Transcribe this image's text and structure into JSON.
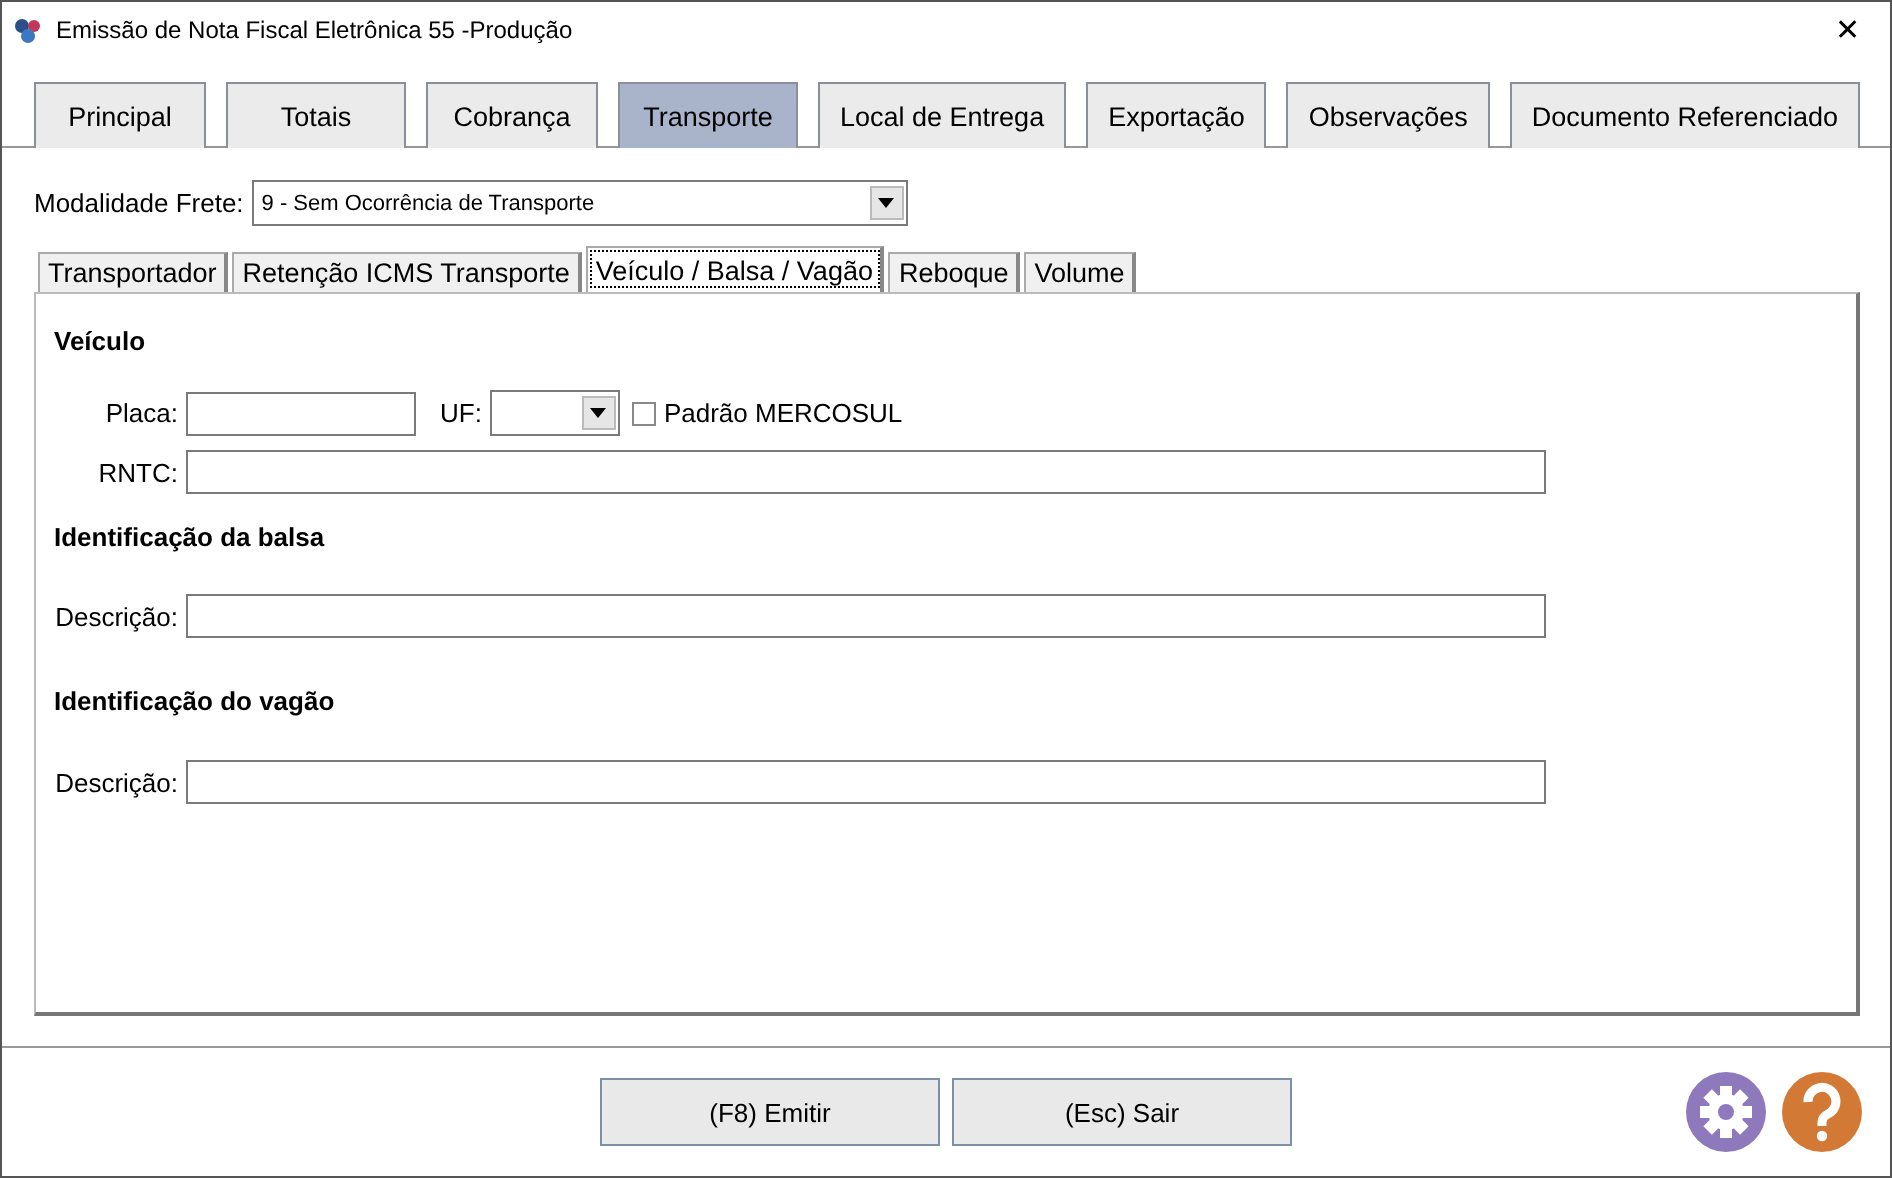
{
  "window": {
    "title": "Emissão de Nota Fiscal Eletrônica 55 -Produção",
    "close": "✕"
  },
  "tabs": [
    {
      "label": "Principal",
      "selected": false
    },
    {
      "label": "Totais",
      "selected": false
    },
    {
      "label": "Cobrança",
      "selected": false
    },
    {
      "label": "Transporte",
      "selected": true
    },
    {
      "label": "Local de Entrega",
      "selected": false
    },
    {
      "label": "Exportação",
      "selected": false
    },
    {
      "label": "Observações",
      "selected": false
    },
    {
      "label": "Documento Referenciado",
      "selected": false
    }
  ],
  "freight": {
    "label": "Modalidade Frete:",
    "value": "9 - Sem Ocorrência de Transporte"
  },
  "subtabs": [
    {
      "label": "Transportador",
      "selected": false
    },
    {
      "label": "Retenção ICMS Transporte",
      "selected": false
    },
    {
      "label": "Veículo / Balsa / Vagão",
      "selected": true
    },
    {
      "label": "Reboque",
      "selected": false
    },
    {
      "label": "Volume",
      "selected": false
    }
  ],
  "vehicle": {
    "heading": "Veículo",
    "plate_label": "Placa:",
    "uf_label": "UF:",
    "mercosul": {
      "label": "Padrão MERCOSUL",
      "checked": false
    },
    "rntc_label": "RNTC:"
  },
  "ferry": {
    "heading": "Identificação da balsa",
    "description_label": "Descrição:"
  },
  "wagon": {
    "heading": "Identificação do vagão",
    "description_label": "Descrição:"
  },
  "buttons": [
    "(F8) Emitir",
    "(Esc) Sair"
  ]
}
